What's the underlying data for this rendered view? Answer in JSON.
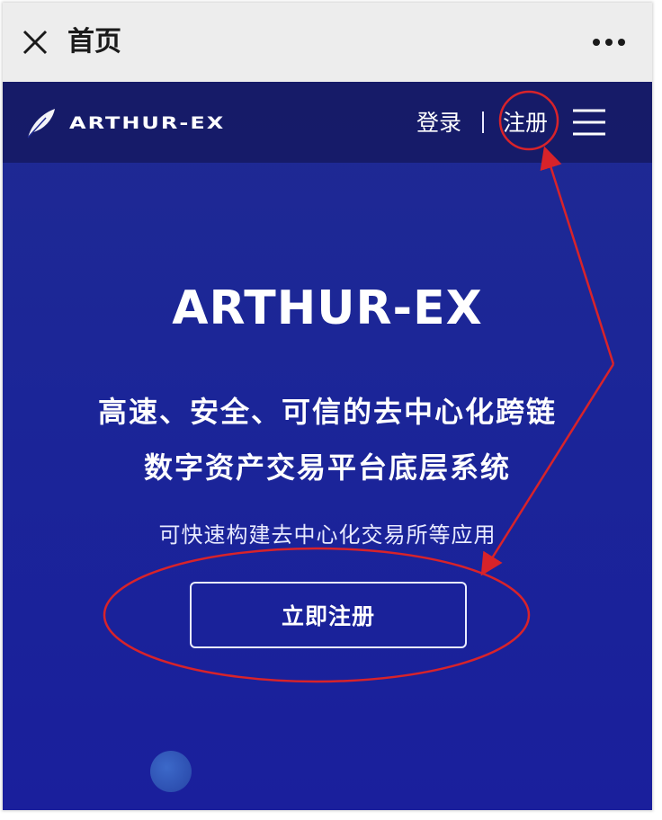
{
  "wechat_bar": {
    "title": "首页",
    "close_icon": "close-icon",
    "more_icon": "more-dots-icon"
  },
  "nav": {
    "logo_text": "ARTHUR-EX",
    "logo_icon": "feather-icon",
    "login_label": "登录",
    "separator": "|",
    "register_label": "注册",
    "menu_icon": "hamburger-menu-icon"
  },
  "hero": {
    "title": "ARTHUR-EX",
    "line1": "高速、安全、可信的去中心化跨链",
    "line2": "数字资产交易平台底层系统",
    "subtitle": "可快速构建去中心化交易所等应用",
    "cta_label": "立即注册"
  },
  "colors": {
    "background_blue": "#1b2598",
    "navbar_dark": "#121452",
    "annotation_red": "#d8232a",
    "text_white": "#ffffff"
  }
}
